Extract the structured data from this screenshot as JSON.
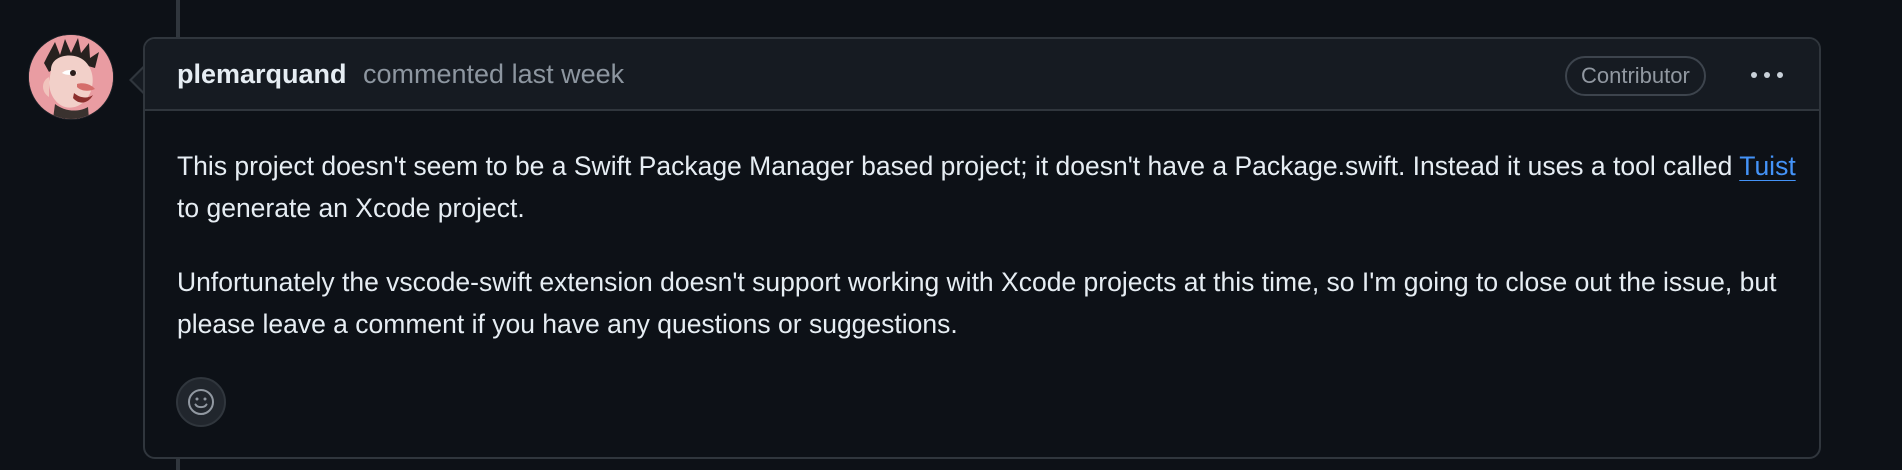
{
  "comment": {
    "author": "plemarquand",
    "action": "commented last week",
    "role_badge": "Contributor",
    "paragraph1_before_link": "This project doesn't seem to be a Swift Package Manager based project; it doesn't have a Package.swift. Instead it uses a tool called ",
    "link_text": "Tuist",
    "paragraph1_after_link": " to generate an Xcode project.",
    "paragraph2": "Unfortunately the vscode-swift extension doesn't support working with Xcode projects at this time, so I'm going to close out the issue, but please leave a comment if you have any questions or suggestions."
  },
  "icons": {
    "avatar": "user-avatar",
    "more": "kebab-horizontal-icon",
    "reaction": "smiley-icon"
  },
  "colors": {
    "background": "#0d1117",
    "header_background": "#161b22",
    "border": "#30363d",
    "text": "#e6edf3",
    "muted_text": "#8d96a0",
    "link": "#4493f8"
  }
}
